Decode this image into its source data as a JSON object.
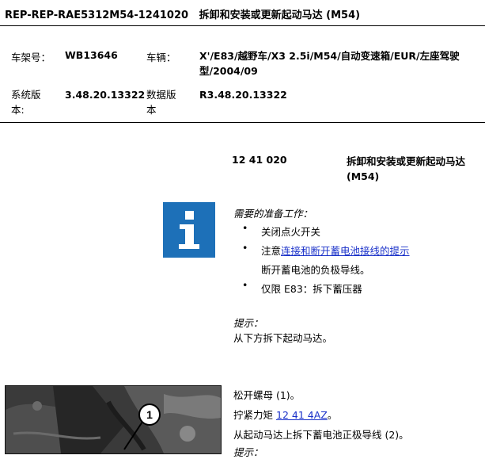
{
  "doc": {
    "id": "REP-REP-RAE5312M54-1241020",
    "title": "拆卸和安装或更新起动马达 (M54)"
  },
  "meta": {
    "vin_label": "车架号：",
    "vin_value": "WB13646",
    "vehicle_label": "车辆：",
    "vehicle_value_line1": "X'/E83/越野车/X3 2.5i/M54/自动变速箱/EUR/左座驾驶",
    "vehicle_value_line2": "型/2004/09",
    "system_version_label_line1": "系统版",
    "system_version_label_line2": "本:",
    "system_version_value": "3.48.20.13322",
    "data_version_label_line1": "数据版",
    "data_version_label_line2": "本",
    "data_version_value": "R3.48.20.13322"
  },
  "procedure": {
    "code": "12 41 020",
    "title_line1": "拆卸和安装或更新起动马达",
    "title_line2": "(M54)"
  },
  "preparation": {
    "heading": "需要的准备工作：",
    "bullet_1": "关闭点火开关",
    "bullet_2_prefix": "注意",
    "bullet_2_link": "连接和断开蓄电池接线的提示",
    "bullet_2_cont": "断开蓄电池的负极导线。",
    "bullet_3": "仅限 E83：拆下蓄压器"
  },
  "note": {
    "heading": "提示：",
    "text": "从下方拆下起动马达。"
  },
  "steps": {
    "step_1": "松开螺母 (1)。",
    "step_2_prefix": "拧紧力矩",
    "step_2_link": "12 41 4AZ",
    "step_2_suffix": "。",
    "step_3": "从起动马达上拆下蓄电池正极导线 (2)。",
    "step_4": "提示："
  },
  "figure": {
    "callout": "1"
  },
  "icons": {
    "info": "info-icon",
    "bullet": "bullet-dot-icon"
  },
  "colors": {
    "info_blue": "#1d70b8",
    "link_blue": "#1a31c9"
  }
}
